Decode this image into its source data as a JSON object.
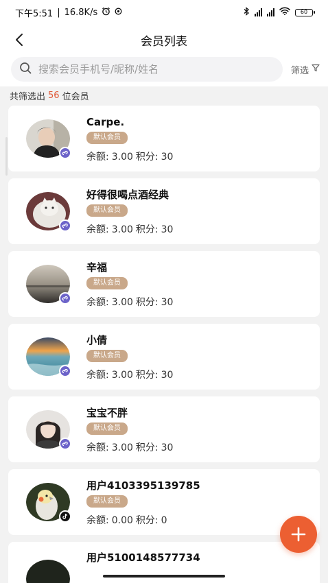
{
  "status": {
    "time": "下午5:51",
    "speed": "16.8K/s",
    "battery": "60"
  },
  "header": {
    "title": "会员列表"
  },
  "search": {
    "placeholder": "搜索会员手机号/昵称/姓名",
    "filter_label": "筛选"
  },
  "summary": {
    "prefix": "共筛选出",
    "count": "56",
    "suffix": "位会员"
  },
  "labels": {
    "balance": "余额:",
    "points": "积分:"
  },
  "members": [
    {
      "name": "Carpe.",
      "tag": "默认会员",
      "balance": "3.00",
      "points": "30",
      "source": "mini-program-icon",
      "avatar": "avatar-portrait-dark"
    },
    {
      "name": "好得很喝点酒经典",
      "tag": "默认会员",
      "balance": "3.00",
      "points": "30",
      "source": "mini-program-icon",
      "avatar": "avatar-cat"
    },
    {
      "name": "辛福",
      "tag": "默认会员",
      "balance": "3.00",
      "points": "30",
      "source": "mini-program-icon",
      "avatar": "avatar-sea-dusk"
    },
    {
      "name": "小倩",
      "tag": "默认会员",
      "balance": "3.00",
      "points": "30",
      "source": "mini-program-icon",
      "avatar": "avatar-sunset-sea"
    },
    {
      "name": "宝宝不胖",
      "tag": "默认会员",
      "balance": "3.00",
      "points": "30",
      "source": "mini-program-icon",
      "avatar": "avatar-girl"
    },
    {
      "name": "用户4103395139785",
      "tag": "默认会员",
      "balance": "0.00",
      "points": "0",
      "source": "tiktok-icon",
      "avatar": "avatar-parrot"
    },
    {
      "name": "用户5100148577734",
      "source": "none",
      "avatar": "avatar-dark"
    }
  ],
  "colors": {
    "accent": "#ec5f32",
    "tag": "#c9a88a",
    "count": "#e05a3a",
    "mini_badge": "#6c63c9"
  }
}
